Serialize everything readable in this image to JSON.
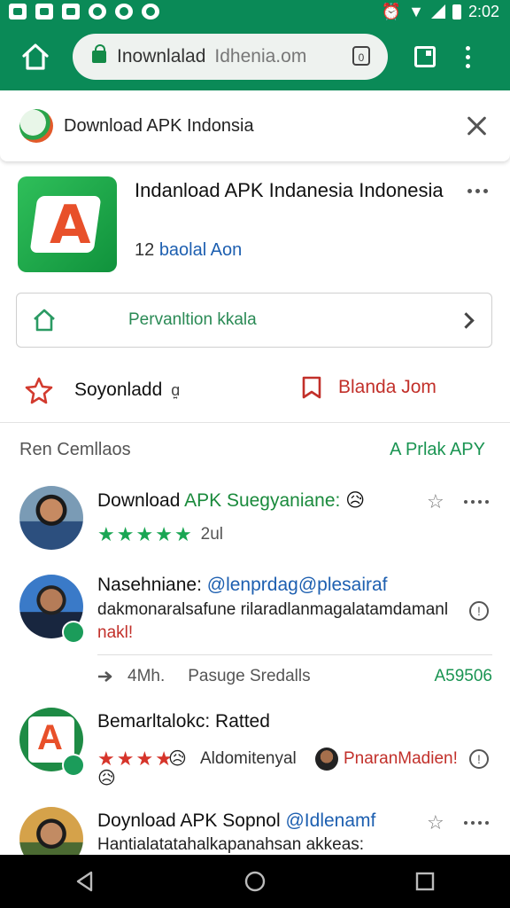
{
  "status_bar": {
    "time": "2:02"
  },
  "browser": {
    "url_path": "Inownlalad",
    "url_domain": "Idhenia.om",
    "tab_count": "0"
  },
  "banner": {
    "title": "Download APK Indonsia"
  },
  "app": {
    "title": "Indanload APK Indanesia Indonesia",
    "sub_number": "12",
    "sub_text": "baolal Aon"
  },
  "permission": {
    "label": "Pervanltion kkala"
  },
  "actions": {
    "left_label": "Soyonladd",
    "left_suffix": "ɑ͍",
    "right_label": "Blanda Jom"
  },
  "reviews": {
    "header": "Ren Cemllaos",
    "link": "A Prlak APY",
    "items": [
      {
        "title_a": "Download ",
        "title_b": "APK ",
        "title_c": "Suegyaniane:",
        "emoji": "😥",
        "rating_meta": "2ul"
      },
      {
        "title_a": "Nasehniane: ",
        "title_b": "@lenprdag@plesairaf",
        "body": "dakmonaralsafune rilaradlanmagalatamdamanl",
        "body_red": "nakl!"
      },
      {
        "title": "Bemarltalokc: Ratted",
        "meta": "Aldomitenyal",
        "mention": "PnaranMadien!",
        "emoji": "😥"
      },
      {
        "title_a": "Doynload APK Sopnol ",
        "title_b": "@Idlenamf",
        "body": "Hantialatatahalkapanahsan akkeas:"
      }
    ],
    "stats": {
      "count": "4Mh.",
      "label": "Pasuge Sredalls",
      "right": "A59506"
    }
  },
  "icons": {
    "home": "home-icon",
    "lock": "lock-icon",
    "close": "close-icon",
    "more": "more-vert-icon",
    "star_outline": "star-outline-icon",
    "bookmark": "bookmark-icon",
    "chevron": "chevron-right-icon",
    "info": "info-icon"
  },
  "colors": {
    "brand_green": "#0a8a57",
    "link_green": "#1a9452",
    "accent_red": "#c2302a",
    "link_blue": "#1d5fb0"
  }
}
